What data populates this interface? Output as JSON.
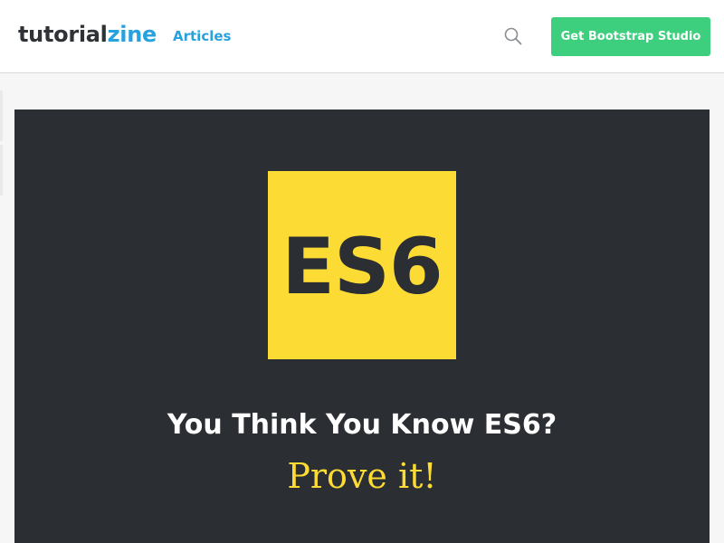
{
  "header": {
    "logo_part_a": "tutorial",
    "logo_part_b": "zine",
    "nav_link": "Articles",
    "search_icon": "search-icon",
    "cta_label": "Get Bootstrap Studio"
  },
  "hero": {
    "logo_text": "ES6",
    "title": "You Think You Know ES6?",
    "subtitle": "Prove it!"
  },
  "colors": {
    "accent_blue": "#27a2dd",
    "cta_green": "#3ecf7e",
    "hero_bg": "#2b2e32",
    "es6_yellow": "#fcdc34"
  }
}
